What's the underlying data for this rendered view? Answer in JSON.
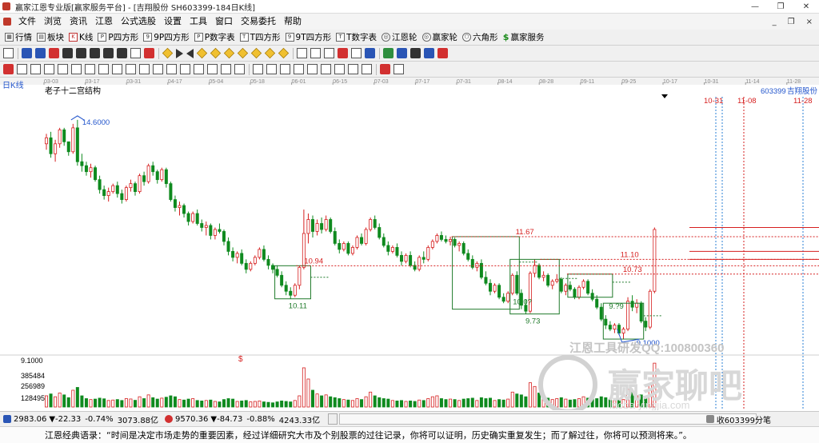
{
  "window": {
    "title": "赢家江恩专业版[赢家服务平台] - [吉翔股份 SH603399-184日K线]",
    "minimize": "—",
    "restore": "❐",
    "close": "✕"
  },
  "menu": {
    "items": [
      "文件",
      "浏览",
      "资讯",
      "江恩",
      "公式选股",
      "设置",
      "工具",
      "窗口",
      "交易委托",
      "帮助"
    ],
    "right": [
      "_",
      "❐",
      "×"
    ]
  },
  "toolbar1": {
    "items": [
      {
        "label": "行情",
        "icon": "grid-icon"
      },
      {
        "label": "板块",
        "icon": "blocks-icon"
      },
      {
        "label": "K线",
        "icon": "kline-icon"
      },
      {
        "label": "P四方形",
        "icon": "p-square-icon"
      },
      {
        "label": "9P四方形",
        "icon": "9p-square-icon"
      },
      {
        "label": "P数字表",
        "icon": "p-table-icon"
      },
      {
        "label": "T四方形",
        "icon": "t-square-icon"
      },
      {
        "label": "9T四方形",
        "icon": "9t-square-icon"
      },
      {
        "label": "T数字表",
        "icon": "t-table-icon"
      },
      {
        "label": "江恩轮",
        "icon": "gann-wheel-icon"
      },
      {
        "label": "赢家轮",
        "icon": "winner-wheel-icon"
      },
      {
        "label": "六角形",
        "icon": "hexagon-icon"
      },
      {
        "label": "赢家服务",
        "icon": "dollar-icon"
      }
    ]
  },
  "chart": {
    "period_label": "日K线",
    "structure_label": "老子十二宫结构",
    "stock_code_label": "603399",
    "stock_name_label": "吉翔股份",
    "dollar_mark": "$",
    "watermark_text": "江恩工具研发QQ:100800360",
    "watermark_logo": "赢家聊吧",
    "watermark_url": "laoba yingjia.com",
    "date_axis": [
      "03-03",
      "03-17",
      "03-31",
      "04-17",
      "05-04",
      "05-18",
      "06-01",
      "06-15",
      "07-03",
      "07-17",
      "07-31",
      "08-14",
      "08-28",
      "09-11",
      "09-25",
      "10-17",
      "10-31",
      "11-14",
      "11-28"
    ],
    "right_markers": [
      "10-31",
      "11-08",
      "11-28"
    ],
    "price_labels": [
      "14.6000",
      "11.67",
      "11.10",
      "10.94",
      "10.73",
      "10.0?",
      "10.11",
      "9.73",
      "9.?9",
      "9.1000"
    ],
    "volume_axis": [
      "9.1000",
      "385484",
      "256989",
      "128495"
    ]
  },
  "chart_data": {
    "type": "candlestick",
    "title": "吉翔股份 SH603399-184日K线",
    "colors": {
      "up": "#d61f1f",
      "down": "#0f8a1f",
      "guide": "#d61f1f",
      "box": "#1f7a2a",
      "future": "#2a7fd4"
    },
    "ylim": [
      8.8,
      15.3
    ],
    "volume_ylim": [
      0,
      514000
    ],
    "candles": [
      {
        "o": 14.0,
        "h": 14.25,
        "l": 13.85,
        "c": 14.15,
        "v": 120000
      },
      {
        "o": 14.15,
        "h": 14.3,
        "l": 13.65,
        "c": 13.75,
        "v": 140000
      },
      {
        "o": 13.75,
        "h": 14.1,
        "l": 13.55,
        "c": 14.0,
        "v": 110000
      },
      {
        "o": 14.0,
        "h": 14.4,
        "l": 13.9,
        "c": 14.35,
        "v": 150000
      },
      {
        "o": 14.35,
        "h": 14.4,
        "l": 13.95,
        "c": 14.05,
        "v": 130000
      },
      {
        "o": 14.05,
        "h": 14.05,
        "l": 13.7,
        "c": 13.8,
        "v": 100000
      },
      {
        "o": 13.8,
        "h": 14.5,
        "l": 13.75,
        "c": 14.4,
        "v": 180000
      },
      {
        "o": 14.4,
        "h": 14.6,
        "l": 13.45,
        "c": 13.55,
        "v": 210000
      },
      {
        "o": 13.55,
        "h": 13.75,
        "l": 13.3,
        "c": 13.45,
        "v": 120000
      },
      {
        "o": 13.45,
        "h": 13.55,
        "l": 13.2,
        "c": 13.3,
        "v": 90000
      },
      {
        "o": 13.3,
        "h": 13.5,
        "l": 13.15,
        "c": 13.4,
        "v": 80000
      },
      {
        "o": 13.4,
        "h": 13.45,
        "l": 13.05,
        "c": 13.1,
        "v": 85000
      },
      {
        "o": 13.1,
        "h": 13.2,
        "l": 12.75,
        "c": 12.85,
        "v": 95000
      },
      {
        "o": 12.85,
        "h": 12.95,
        "l": 12.6,
        "c": 12.7,
        "v": 88000
      },
      {
        "o": 12.7,
        "h": 12.9,
        "l": 12.55,
        "c": 12.8,
        "v": 70000
      },
      {
        "o": 12.8,
        "h": 13.0,
        "l": 12.75,
        "c": 12.95,
        "v": 75000
      },
      {
        "o": 12.95,
        "h": 13.05,
        "l": 12.65,
        "c": 12.75,
        "v": 80000
      },
      {
        "o": 12.75,
        "h": 12.85,
        "l": 12.5,
        "c": 12.6,
        "v": 70000
      },
      {
        "o": 12.6,
        "h": 12.95,
        "l": 12.55,
        "c": 12.9,
        "v": 90000
      },
      {
        "o": 12.9,
        "h": 13.1,
        "l": 12.8,
        "c": 13.0,
        "v": 86000
      },
      {
        "o": 13.0,
        "h": 13.05,
        "l": 12.7,
        "c": 12.8,
        "v": 72000
      },
      {
        "o": 12.8,
        "h": 13.25,
        "l": 12.75,
        "c": 13.2,
        "v": 110000
      },
      {
        "o": 13.2,
        "h": 13.3,
        "l": 12.95,
        "c": 13.05,
        "v": 90000
      },
      {
        "o": 13.05,
        "h": 13.5,
        "l": 13.0,
        "c": 13.45,
        "v": 130000
      },
      {
        "o": 13.45,
        "h": 13.55,
        "l": 13.2,
        "c": 13.3,
        "v": 100000
      },
      {
        "o": 13.3,
        "h": 13.35,
        "l": 13.0,
        "c": 13.1,
        "v": 85000
      },
      {
        "o": 13.1,
        "h": 13.4,
        "l": 13.05,
        "c": 13.35,
        "v": 95000
      },
      {
        "o": 13.35,
        "h": 13.4,
        "l": 12.9,
        "c": 13.0,
        "v": 105000
      },
      {
        "o": 13.0,
        "h": 13.05,
        "l": 12.55,
        "c": 12.6,
        "v": 120000
      },
      {
        "o": 12.6,
        "h": 12.7,
        "l": 12.3,
        "c": 12.4,
        "v": 110000
      },
      {
        "o": 12.4,
        "h": 12.55,
        "l": 12.2,
        "c": 12.45,
        "v": 80000
      },
      {
        "o": 12.45,
        "h": 12.5,
        "l": 12.15,
        "c": 12.25,
        "v": 75000
      },
      {
        "o": 12.25,
        "h": 12.3,
        "l": 11.95,
        "c": 12.05,
        "v": 85000
      },
      {
        "o": 12.05,
        "h": 12.3,
        "l": 12.0,
        "c": 12.25,
        "v": 90000
      },
      {
        "o": 12.25,
        "h": 12.35,
        "l": 11.95,
        "c": 12.0,
        "v": 70000
      },
      {
        "o": 12.0,
        "h": 12.1,
        "l": 11.8,
        "c": 11.9,
        "v": 65000
      },
      {
        "o": 11.9,
        "h": 12.05,
        "l": 11.7,
        "c": 11.95,
        "v": 70000
      },
      {
        "o": 11.95,
        "h": 12.0,
        "l": 11.6,
        "c": 11.7,
        "v": 75000
      },
      {
        "o": 11.7,
        "h": 11.9,
        "l": 11.6,
        "c": 11.85,
        "v": 60000
      },
      {
        "o": 11.85,
        "h": 12.0,
        "l": 11.75,
        "c": 11.8,
        "v": 55000
      },
      {
        "o": 11.8,
        "h": 11.85,
        "l": 11.45,
        "c": 11.55,
        "v": 80000
      },
      {
        "o": 11.55,
        "h": 11.65,
        "l": 11.2,
        "c": 11.3,
        "v": 90000
      },
      {
        "o": 11.3,
        "h": 11.4,
        "l": 11.05,
        "c": 11.15,
        "v": 85000
      },
      {
        "o": 11.15,
        "h": 11.3,
        "l": 11.0,
        "c": 11.25,
        "v": 60000
      },
      {
        "o": 11.25,
        "h": 11.35,
        "l": 10.95,
        "c": 11.0,
        "v": 65000
      },
      {
        "o": 11.0,
        "h": 11.1,
        "l": 10.75,
        "c": 10.85,
        "v": 70000
      },
      {
        "o": 10.85,
        "h": 11.05,
        "l": 10.8,
        "c": 11.0,
        "v": 55000
      },
      {
        "o": 11.0,
        "h": 11.2,
        "l": 10.95,
        "c": 11.15,
        "v": 60000
      },
      {
        "o": 11.15,
        "h": 11.4,
        "l": 11.1,
        "c": 11.35,
        "v": 65000
      },
      {
        "o": 11.35,
        "h": 11.45,
        "l": 11.05,
        "c": 11.1,
        "v": 55000
      },
      {
        "o": 11.1,
        "h": 11.2,
        "l": 10.85,
        "c": 10.95,
        "v": 50000
      },
      {
        "o": 10.95,
        "h": 11.0,
        "l": 10.75,
        "c": 10.85,
        "v": 45000
      },
      {
        "o": 10.85,
        "h": 10.95,
        "l": 10.65,
        "c": 10.7,
        "v": 55000
      },
      {
        "o": 10.7,
        "h": 10.8,
        "l": 10.4,
        "c": 10.45,
        "v": 65000
      },
      {
        "o": 10.45,
        "h": 10.55,
        "l": 10.2,
        "c": 10.3,
        "v": 60000
      },
      {
        "o": 10.3,
        "h": 10.4,
        "l": 10.11,
        "c": 10.2,
        "v": 55000
      },
      {
        "o": 10.2,
        "h": 10.5,
        "l": 10.15,
        "c": 10.45,
        "v": 70000
      },
      {
        "o": 10.45,
        "h": 10.94,
        "l": 10.35,
        "c": 10.9,
        "v": 120000
      },
      {
        "o": 10.9,
        "h": 12.35,
        "l": 10.85,
        "c": 11.75,
        "v": 420000
      },
      {
        "o": 11.75,
        "h": 12.25,
        "l": 11.5,
        "c": 12.1,
        "v": 300000
      },
      {
        "o": 12.1,
        "h": 12.2,
        "l": 11.65,
        "c": 11.8,
        "v": 180000
      },
      {
        "o": 11.8,
        "h": 12.1,
        "l": 11.7,
        "c": 12.0,
        "v": 140000
      },
      {
        "o": 12.0,
        "h": 12.15,
        "l": 11.75,
        "c": 11.85,
        "v": 120000
      },
      {
        "o": 11.85,
        "h": 12.2,
        "l": 11.8,
        "c": 12.1,
        "v": 130000
      },
      {
        "o": 12.1,
        "h": 12.15,
        "l": 11.75,
        "c": 11.8,
        "v": 110000
      },
      {
        "o": 11.8,
        "h": 11.9,
        "l": 11.45,
        "c": 11.5,
        "v": 100000
      },
      {
        "o": 11.5,
        "h": 11.6,
        "l": 11.25,
        "c": 11.35,
        "v": 90000
      },
      {
        "o": 11.35,
        "h": 11.55,
        "l": 11.3,
        "c": 11.5,
        "v": 80000
      },
      {
        "o": 11.5,
        "h": 11.55,
        "l": 11.2,
        "c": 11.25,
        "v": 75000
      },
      {
        "o": 11.25,
        "h": 11.45,
        "l": 11.2,
        "c": 11.4,
        "v": 70000
      },
      {
        "o": 11.4,
        "h": 11.7,
        "l": 11.35,
        "c": 11.65,
        "v": 90000
      },
      {
        "o": 11.65,
        "h": 11.75,
        "l": 11.45,
        "c": 11.5,
        "v": 80000
      },
      {
        "o": 11.5,
        "h": 11.9,
        "l": 11.45,
        "c": 11.85,
        "v": 110000
      },
      {
        "o": 11.85,
        "h": 12.15,
        "l": 11.8,
        "c": 12.1,
        "v": 160000
      },
      {
        "o": 12.1,
        "h": 12.2,
        "l": 11.85,
        "c": 11.9,
        "v": 120000
      },
      {
        "o": 11.9,
        "h": 12.0,
        "l": 11.6,
        "c": 11.65,
        "v": 100000
      },
      {
        "o": 11.65,
        "h": 11.75,
        "l": 11.4,
        "c": 11.45,
        "v": 90000
      },
      {
        "o": 11.45,
        "h": 11.55,
        "l": 11.2,
        "c": 11.3,
        "v": 85000
      },
      {
        "o": 11.3,
        "h": 11.45,
        "l": 11.25,
        "c": 11.4,
        "v": 70000
      },
      {
        "o": 11.4,
        "h": 11.5,
        "l": 11.15,
        "c": 11.2,
        "v": 65000
      },
      {
        "o": 11.2,
        "h": 11.3,
        "l": 10.95,
        "c": 11.05,
        "v": 70000
      },
      {
        "o": 11.05,
        "h": 11.25,
        "l": 11.0,
        "c": 11.2,
        "v": 60000
      },
      {
        "o": 11.2,
        "h": 11.3,
        "l": 10.9,
        "c": 10.95,
        "v": 65000
      },
      {
        "o": 10.95,
        "h": 11.05,
        "l": 10.8,
        "c": 10.85,
        "v": 60000
      },
      {
        "o": 10.85,
        "h": 11.2,
        "l": 10.8,
        "c": 11.15,
        "v": 75000
      },
      {
        "o": 11.15,
        "h": 11.3,
        "l": 11.0,
        "c": 11.1,
        "v": 70000
      },
      {
        "o": 11.1,
        "h": 11.45,
        "l": 11.05,
        "c": 11.4,
        "v": 90000
      },
      {
        "o": 11.4,
        "h": 11.6,
        "l": 11.35,
        "c": 11.55,
        "v": 110000
      },
      {
        "o": 11.55,
        "h": 11.75,
        "l": 11.5,
        "c": 11.7,
        "v": 120000
      },
      {
        "o": 11.7,
        "h": 11.8,
        "l": 11.55,
        "c": 11.6,
        "v": 90000
      },
      {
        "o": 11.6,
        "h": 11.7,
        "l": 11.5,
        "c": 11.55,
        "v": 80000
      },
      {
        "o": 11.55,
        "h": 11.67,
        "l": 11.45,
        "c": 11.6,
        "v": 85000
      },
      {
        "o": 11.6,
        "h": 11.65,
        "l": 11.4,
        "c": 11.45,
        "v": 80000
      },
      {
        "o": 11.45,
        "h": 11.55,
        "l": 11.3,
        "c": 11.5,
        "v": 70000
      },
      {
        "o": 11.5,
        "h": 11.55,
        "l": 11.2,
        "c": 11.25,
        "v": 85000
      },
      {
        "o": 11.25,
        "h": 11.35,
        "l": 11.05,
        "c": 11.1,
        "v": 90000
      },
      {
        "o": 11.1,
        "h": 11.2,
        "l": 10.85,
        "c": 10.9,
        "v": 95000
      },
      {
        "o": 10.9,
        "h": 11.05,
        "l": 10.8,
        "c": 11.0,
        "v": 70000
      },
      {
        "o": 11.0,
        "h": 11.1,
        "l": 10.6,
        "c": 10.65,
        "v": 100000
      },
      {
        "o": 10.65,
        "h": 10.8,
        "l": 10.45,
        "c": 10.5,
        "v": 90000
      },
      {
        "o": 10.5,
        "h": 10.6,
        "l": 10.2,
        "c": 10.3,
        "v": 95000
      },
      {
        "o": 10.3,
        "h": 10.5,
        "l": 10.25,
        "c": 10.45,
        "v": 70000
      },
      {
        "o": 10.45,
        "h": 10.5,
        "l": 10.1,
        "c": 10.15,
        "v": 80000
      },
      {
        "o": 10.15,
        "h": 10.25,
        "l": 10.0,
        "c": 10.05,
        "v": 75000
      },
      {
        "o": 10.05,
        "h": 10.3,
        "l": 10.0,
        "c": 10.25,
        "v": 85000
      },
      {
        "o": 10.25,
        "h": 10.75,
        "l": 10.2,
        "c": 10.7,
        "v": 160000
      },
      {
        "o": 10.7,
        "h": 10.8,
        "l": 10.2,
        "c": 10.25,
        "v": 140000
      },
      {
        "o": 10.25,
        "h": 10.35,
        "l": 9.85,
        "c": 9.95,
        "v": 130000
      },
      {
        "o": 9.95,
        "h": 10.1,
        "l": 9.73,
        "c": 9.8,
        "v": 110000
      },
      {
        "o": 9.8,
        "h": 10.8,
        "l": 9.75,
        "c": 10.75,
        "v": 260000
      },
      {
        "o": 10.75,
        "h": 11.1,
        "l": 10.65,
        "c": 10.95,
        "v": 220000
      },
      {
        "o": 10.95,
        "h": 11.0,
        "l": 10.6,
        "c": 10.65,
        "v": 150000
      },
      {
        "o": 10.65,
        "h": 10.8,
        "l": 10.55,
        "c": 10.7,
        "v": 100000
      },
      {
        "o": 10.7,
        "h": 10.75,
        "l": 10.4,
        "c": 10.45,
        "v": 95000
      },
      {
        "o": 10.45,
        "h": 10.6,
        "l": 10.35,
        "c": 10.55,
        "v": 80000
      },
      {
        "o": 10.55,
        "h": 10.73,
        "l": 10.5,
        "c": 10.6,
        "v": 90000
      },
      {
        "o": 10.6,
        "h": 10.65,
        "l": 10.25,
        "c": 10.3,
        "v": 100000
      },
      {
        "o": 10.3,
        "h": 10.5,
        "l": 10.2,
        "c": 10.45,
        "v": 85000
      },
      {
        "o": 10.45,
        "h": 10.55,
        "l": 10.3,
        "c": 10.35,
        "v": 75000
      },
      {
        "o": 10.35,
        "h": 10.4,
        "l": 10.1,
        "c": 10.15,
        "v": 80000
      },
      {
        "o": 10.15,
        "h": 10.45,
        "l": 10.1,
        "c": 10.4,
        "v": 90000
      },
      {
        "o": 10.4,
        "h": 10.6,
        "l": 10.35,
        "c": 10.55,
        "v": 110000
      },
      {
        "o": 10.55,
        "h": 10.6,
        "l": 10.2,
        "c": 10.25,
        "v": 95000
      },
      {
        "o": 10.25,
        "h": 10.35,
        "l": 10.05,
        "c": 10.1,
        "v": 85000
      },
      {
        "o": 10.1,
        "h": 10.2,
        "l": 9.85,
        "c": 9.9,
        "v": 90000
      },
      {
        "o": 9.9,
        "h": 10.0,
        "l": 9.55,
        "c": 9.6,
        "v": 110000
      },
      {
        "o": 9.6,
        "h": 9.7,
        "l": 9.35,
        "c": 9.45,
        "v": 100000
      },
      {
        "o": 9.45,
        "h": 9.55,
        "l": 9.3,
        "c": 9.35,
        "v": 80000
      },
      {
        "o": 9.35,
        "h": 9.5,
        "l": 9.25,
        "c": 9.45,
        "v": 70000
      },
      {
        "o": 9.45,
        "h": 9.5,
        "l": 9.2,
        "c": 9.25,
        "v": 75000
      },
      {
        "o": 9.25,
        "h": 9.4,
        "l": 9.1,
        "c": 9.35,
        "v": 80000
      },
      {
        "o": 9.35,
        "h": 10.15,
        "l": 9.3,
        "c": 10.05,
        "v": 190000
      },
      {
        "o": 10.05,
        "h": 10.2,
        "l": 9.8,
        "c": 9.9,
        "v": 160000
      },
      {
        "o": 9.9,
        "h": 10.1,
        "l": 9.75,
        "c": 10.0,
        "v": 120000
      },
      {
        "o": 10.0,
        "h": 10.05,
        "l": 9.5,
        "c": 9.55,
        "v": 130000
      },
      {
        "o": 9.55,
        "h": 9.65,
        "l": 9.3,
        "c": 9.4,
        "v": 110000
      },
      {
        "o": 9.4,
        "h": 10.35,
        "l": 9.35,
        "c": 10.3,
        "v": 240000
      },
      {
        "o": 10.3,
        "h": 11.9,
        "l": 10.25,
        "c": 11.85,
        "v": 470000
      }
    ],
    "annotations": {
      "peak": {
        "index": 7,
        "value": 14.6
      },
      "low": {
        "index": 134,
        "value": 9.1
      },
      "levels": [
        {
          "value": 11.67,
          "text": "11.67",
          "from": 92
        },
        {
          "value": 11.1,
          "text": "11.10",
          "from": 112
        },
        {
          "value": 10.94,
          "text": "10.94",
          "from": 57
        },
        {
          "value": 10.73,
          "text": "10.73",
          "from": 118
        }
      ],
      "boxes": [
        {
          "from": 52,
          "to": 59,
          "high": 10.94,
          "low": 10.11,
          "low_text": "10.11"
        },
        {
          "from": 92,
          "to": 106,
          "high": 11.67,
          "low": 9.85
        },
        {
          "from": 105,
          "to": 115,
          "high": 11.1,
          "low": 9.73,
          "low_text": "9.73"
        },
        {
          "from": 118,
          "to": 127,
          "high": 10.73,
          "low": 10.15
        },
        {
          "from": 126,
          "to": 134,
          "high": 10.0,
          "low": 9.1
        }
      ]
    }
  },
  "status": {
    "sh_index": "2983.06",
    "sh_change": "▼-22.33",
    "sh_pct": "-0.74%",
    "sh_amount": "3073.88亿",
    "sz_index": "9570.36",
    "sz_change": "▼-84.73",
    "sz_pct": "-0.88%",
    "sz_amount": "4243.33亿",
    "right_label": "收603399分笔"
  },
  "quote": {
    "text": "江恩经典语录：“时间是决定市场走势的重要因素，经过详细研究大市及个别股票的过往记录，你将可以证明，历史确实重复发生；而了解过往，你将可以预测将来。”。"
  }
}
